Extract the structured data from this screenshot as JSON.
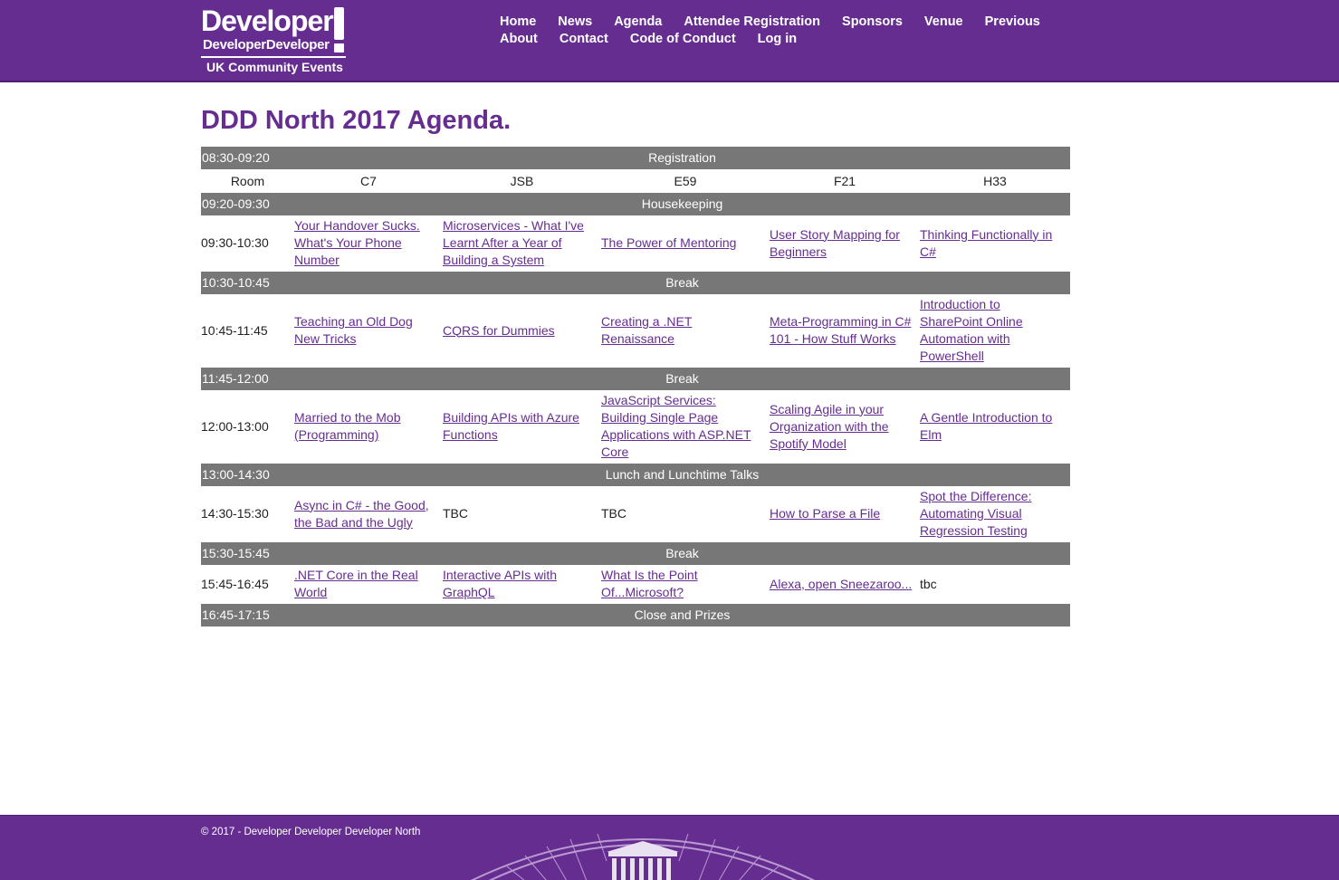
{
  "header": {
    "logo": {
      "line1": "Developer",
      "line2": "DeveloperDeveloper",
      "line3": "UK Community Events"
    },
    "nav_row1": [
      "Home",
      "News",
      "Agenda",
      "Attendee Registration",
      "Sponsors",
      "Venue",
      "Previous"
    ],
    "nav_row2": [
      "About",
      "Contact",
      "Code of Conduct",
      "Log in"
    ]
  },
  "page": {
    "title": "DDD North 2017 Agenda."
  },
  "agenda": {
    "rooms_label": "Room",
    "rooms": [
      "C7",
      "JSB",
      "E59",
      "F21",
      "H33"
    ],
    "rows": [
      {
        "type": "bar",
        "time": "08:30-09:20",
        "label": "Registration"
      },
      {
        "type": "rooms"
      },
      {
        "type": "bar",
        "time": "09:20-09:30",
        "label": "Housekeeping"
      },
      {
        "type": "slot",
        "time": "09:30-10:30",
        "sessions": [
          {
            "title": "Your Handover Sucks. What's Your Phone Number",
            "link": true
          },
          {
            "title": "Microservices - What I've Learnt After a Year of Building a System",
            "link": true
          },
          {
            "title": "The Power of Mentoring",
            "link": true
          },
          {
            "title": "User Story Mapping for Beginners",
            "link": true
          },
          {
            "title": "Thinking Functionally in C#",
            "link": true
          }
        ]
      },
      {
        "type": "bar",
        "time": "10:30-10:45",
        "label": "Break"
      },
      {
        "type": "slot",
        "time": "10:45-11:45",
        "sessions": [
          {
            "title": "Teaching an Old Dog New Tricks",
            "link": true
          },
          {
            "title": "CQRS for Dummies",
            "link": true
          },
          {
            "title": "Creating a .NET Renaissance",
            "link": true
          },
          {
            "title": "Meta-Programming in C# 101 - How Stuff Works",
            "link": true
          },
          {
            "title": "Introduction to SharePoint Online Automation with PowerShell",
            "link": true
          }
        ]
      },
      {
        "type": "bar",
        "time": "11:45-12:00",
        "label": "Break"
      },
      {
        "type": "slot",
        "time": "12:00-13:00",
        "sessions": [
          {
            "title": "Married to the Mob (Programming)",
            "link": true
          },
          {
            "title": "Building APIs with Azure Functions",
            "link": true
          },
          {
            "title": "JavaScript Services: Building Single Page Applications with ASP.NET Core",
            "link": true
          },
          {
            "title": "Scaling Agile in your Organization with the Spotify Model",
            "link": true
          },
          {
            "title": "A Gentle Introduction to Elm",
            "link": true
          }
        ]
      },
      {
        "type": "bar",
        "time": "13:00-14:30",
        "label": "Lunch and Lunchtime Talks"
      },
      {
        "type": "slot",
        "time": "14:30-15:30",
        "sessions": [
          {
            "title": "Async in C# - the Good, the Bad and the Ugly",
            "link": true
          },
          {
            "title": "TBC",
            "link": false
          },
          {
            "title": "TBC",
            "link": false
          },
          {
            "title": "How to Parse a File",
            "link": true
          },
          {
            "title": "Spot the Difference: Automating Visual Regression Testing",
            "link": true
          }
        ]
      },
      {
        "type": "bar",
        "time": "15:30-15:45",
        "label": "Break"
      },
      {
        "type": "slot",
        "time": "15:45-16:45",
        "sessions": [
          {
            "title": ".NET Core in the Real World",
            "link": true
          },
          {
            "title": "Interactive APIs with GraphQL",
            "link": true
          },
          {
            "title": "What Is the Point Of...Microsoft?",
            "link": true
          },
          {
            "title": "Alexa, open Sneezaroo...",
            "link": true
          },
          {
            "title": "tbc",
            "link": false
          }
        ]
      },
      {
        "type": "bar",
        "time": "16:45-17:15",
        "label": "Close and Prizes"
      }
    ]
  },
  "footer": {
    "copyright": "© 2017 - Developer Developer Developer North"
  },
  "colors": {
    "brand": "#662d91",
    "bar": "#777777",
    "link": "#662d91"
  }
}
